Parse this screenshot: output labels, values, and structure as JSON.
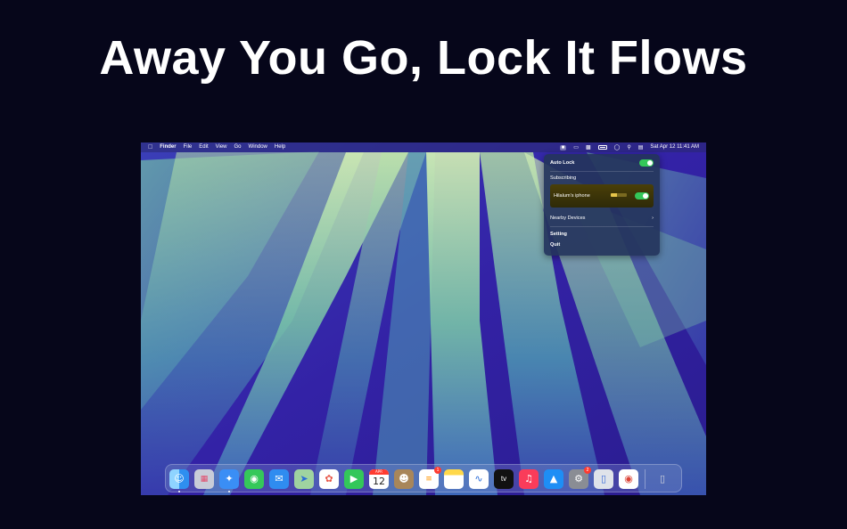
{
  "headline": "Away You Go, Lock It Flows",
  "menubar": {
    "app_name": "Finder",
    "menus": [
      "File",
      "Edit",
      "View",
      "Go",
      "Window",
      "Help"
    ],
    "datetime": "Sat Apr 12  11:41 AM"
  },
  "panel": {
    "auto_lock_label": "Auto Lock",
    "auto_lock_on": true,
    "subscribing_label": "Subscribing",
    "device_name": "Hilalum's iphone",
    "device_on": true,
    "nearby_label": "Nearby Devices",
    "setting_label": "Setting",
    "quit_label": "Quit"
  },
  "dock": {
    "calendar_month": "APR",
    "calendar_day": "12",
    "reminders_badge": "1",
    "settings_badge": "2",
    "tv_label": "tv",
    "icons": [
      "finder-icon",
      "launchpad-icon",
      "safari-icon",
      "messages-icon",
      "mail-icon",
      "maps-icon",
      "photos-icon",
      "facetime-icon",
      "calendar-icon",
      "contacts-icon",
      "reminders-icon",
      "notes-icon",
      "freeform-icon",
      "apple-tv-icon",
      "music-icon",
      "app-store-icon",
      "system-settings-icon",
      "iphone-mirroring-icon",
      "chrome-icon",
      "trash-icon"
    ]
  },
  "colors": {
    "background": "#06061a",
    "toggle_green": "#34c759",
    "panel_bg": "#24345c",
    "wallpaper_purple": "#3b2bb0",
    "wallpaper_teal": "#5fb8a0"
  }
}
